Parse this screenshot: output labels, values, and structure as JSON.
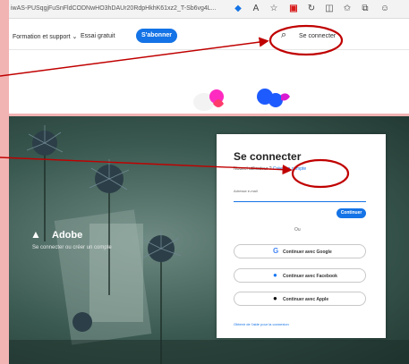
{
  "browser": {
    "url": "iwAS-PUSqgjFuSnFldCODNwHO3hDAUr20RdpHkhK61xz2_T-Sb6vg4L..."
  },
  "top_nav": {
    "formation": "Formation et support ⌄",
    "essai": "Essai gratuit",
    "subscribe": "S'abonner",
    "connect": "Se connecter"
  },
  "brand": {
    "name": "Adobe",
    "tagline": "Se connecter ou créer un compte"
  },
  "login": {
    "title": "Se connecter",
    "subtitle_prefix": "Nouvel utilisateur ? ",
    "subtitle_link": "Créer un compte",
    "email_label": "Adresse e-mail",
    "email_value": "",
    "continue": "Continuer",
    "or": "Ou",
    "google": "Continuer avec Google",
    "facebook": "Continuer avec Facebook",
    "apple": "Continuer avec Apple",
    "help": "Obtenir de l'aide pour la connexion"
  },
  "colors": {
    "accent": "#1473e6",
    "annotation": "#c00000",
    "backdrop": "#f2b3b3"
  }
}
